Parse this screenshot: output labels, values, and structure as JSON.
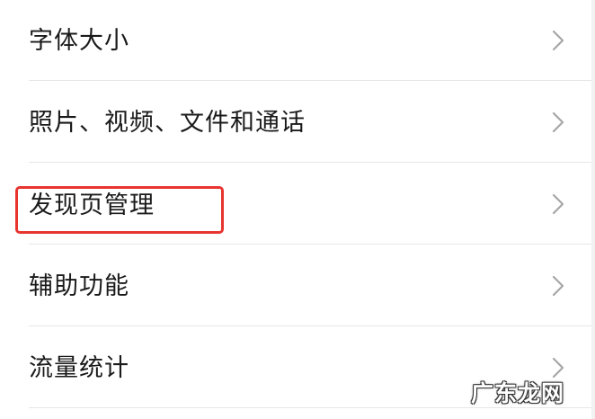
{
  "settings_list": {
    "items": [
      {
        "label": "字体大小",
        "icon": "chevron-right-icon"
      },
      {
        "label": "照片、视频、文件和通话",
        "icon": "chevron-right-icon"
      },
      {
        "label": "发现页管理",
        "icon": "chevron-right-icon",
        "highlighted": true
      },
      {
        "label": "辅助功能",
        "icon": "chevron-right-icon"
      },
      {
        "label": "流量统计",
        "icon": "chevron-right-icon"
      }
    ]
  },
  "highlight_color": "#e8342f",
  "watermark": {
    "text": "广东龙网"
  }
}
